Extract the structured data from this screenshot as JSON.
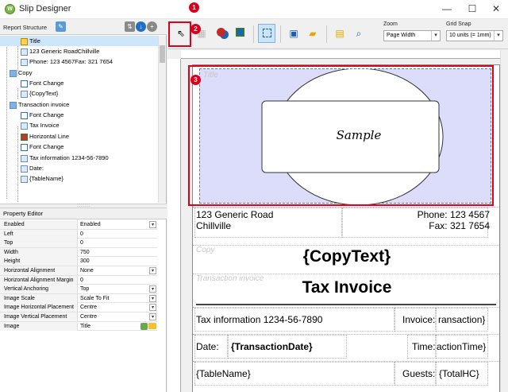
{
  "window": {
    "title": "Slip Designer",
    "app_icon_glyph": "W",
    "minimize_glyph": "—",
    "maximize_glyph": "☐",
    "close_glyph": "✕"
  },
  "report_structure": {
    "label": "Report Structure",
    "items": [
      {
        "label": "Title",
        "selected": true
      },
      {
        "label": "123 Generic RoadChillville"
      },
      {
        "label": "Phone: 123 4567Fax: 321 7654"
      },
      {
        "label": "Copy"
      },
      {
        "label": "Font Change"
      },
      {
        "label": "{CopyText}"
      },
      {
        "label": "Transaction invoice"
      },
      {
        "label": "Font Change"
      },
      {
        "label": "Tax Invoice"
      },
      {
        "label": "Horizontal Line"
      },
      {
        "label": "Font Change"
      },
      {
        "label": "Tax information 1234-56-7890"
      },
      {
        "label": "Date:"
      },
      {
        "label": "{TableName}"
      }
    ]
  },
  "property_editor": {
    "label": "Property Editor",
    "rows": [
      {
        "key": "Enabled",
        "value": "Enabled",
        "dropdown": true
      },
      {
        "key": "Left",
        "value": "0"
      },
      {
        "key": "Top",
        "value": "0"
      },
      {
        "key": "Width",
        "value": "750"
      },
      {
        "key": "Height",
        "value": "300"
      },
      {
        "key": "Horizontal Alignment",
        "value": "None",
        "dropdown": true
      },
      {
        "key": "Horizontal Alignment Margin",
        "value": "0"
      },
      {
        "key": "Vertical Anchoring",
        "value": "Top",
        "dropdown": true
      },
      {
        "key": "Image Scale",
        "value": "Scale To Fit",
        "dropdown": true
      },
      {
        "key": "Image Horizontal Placement",
        "value": "Centre",
        "dropdown": true
      },
      {
        "key": "Image Vertical Placement",
        "value": "Centre",
        "dropdown": true
      },
      {
        "key": "Image",
        "value": "Title"
      }
    ]
  },
  "toolbar": {
    "zoom_label": "Zoom",
    "zoom_value": "Page Width",
    "grid_label": "Grid Snap",
    "grid_value": "10 units (= 1mm)",
    "pointer_glyph": "⇖"
  },
  "callouts": [
    "1",
    "2",
    "3"
  ],
  "canvas": {
    "title_band_label": "Title",
    "sample_text": "Sample",
    "address": "123 Generic Road",
    "city": "Chillville",
    "phone": "Phone: 123 4567",
    "fax": "Fax: 321 7654",
    "copy_label": "Copy",
    "copy_text": "{CopyText}",
    "transaction_label": "Transaction invoice",
    "tax_invoice": "Tax Invoice",
    "tax_info": "Tax information 1234-56-7890",
    "invoice_label": "Invoice:",
    "invoice_value": "ransaction}",
    "date_label": "Date:",
    "date_value": "{TransactionDate}",
    "time_label": "Time:",
    "time_value": "actionTime}",
    "table_name": "{TableName}",
    "guests_label": "Guests:",
    "guests_value": "{TotalHC}"
  }
}
